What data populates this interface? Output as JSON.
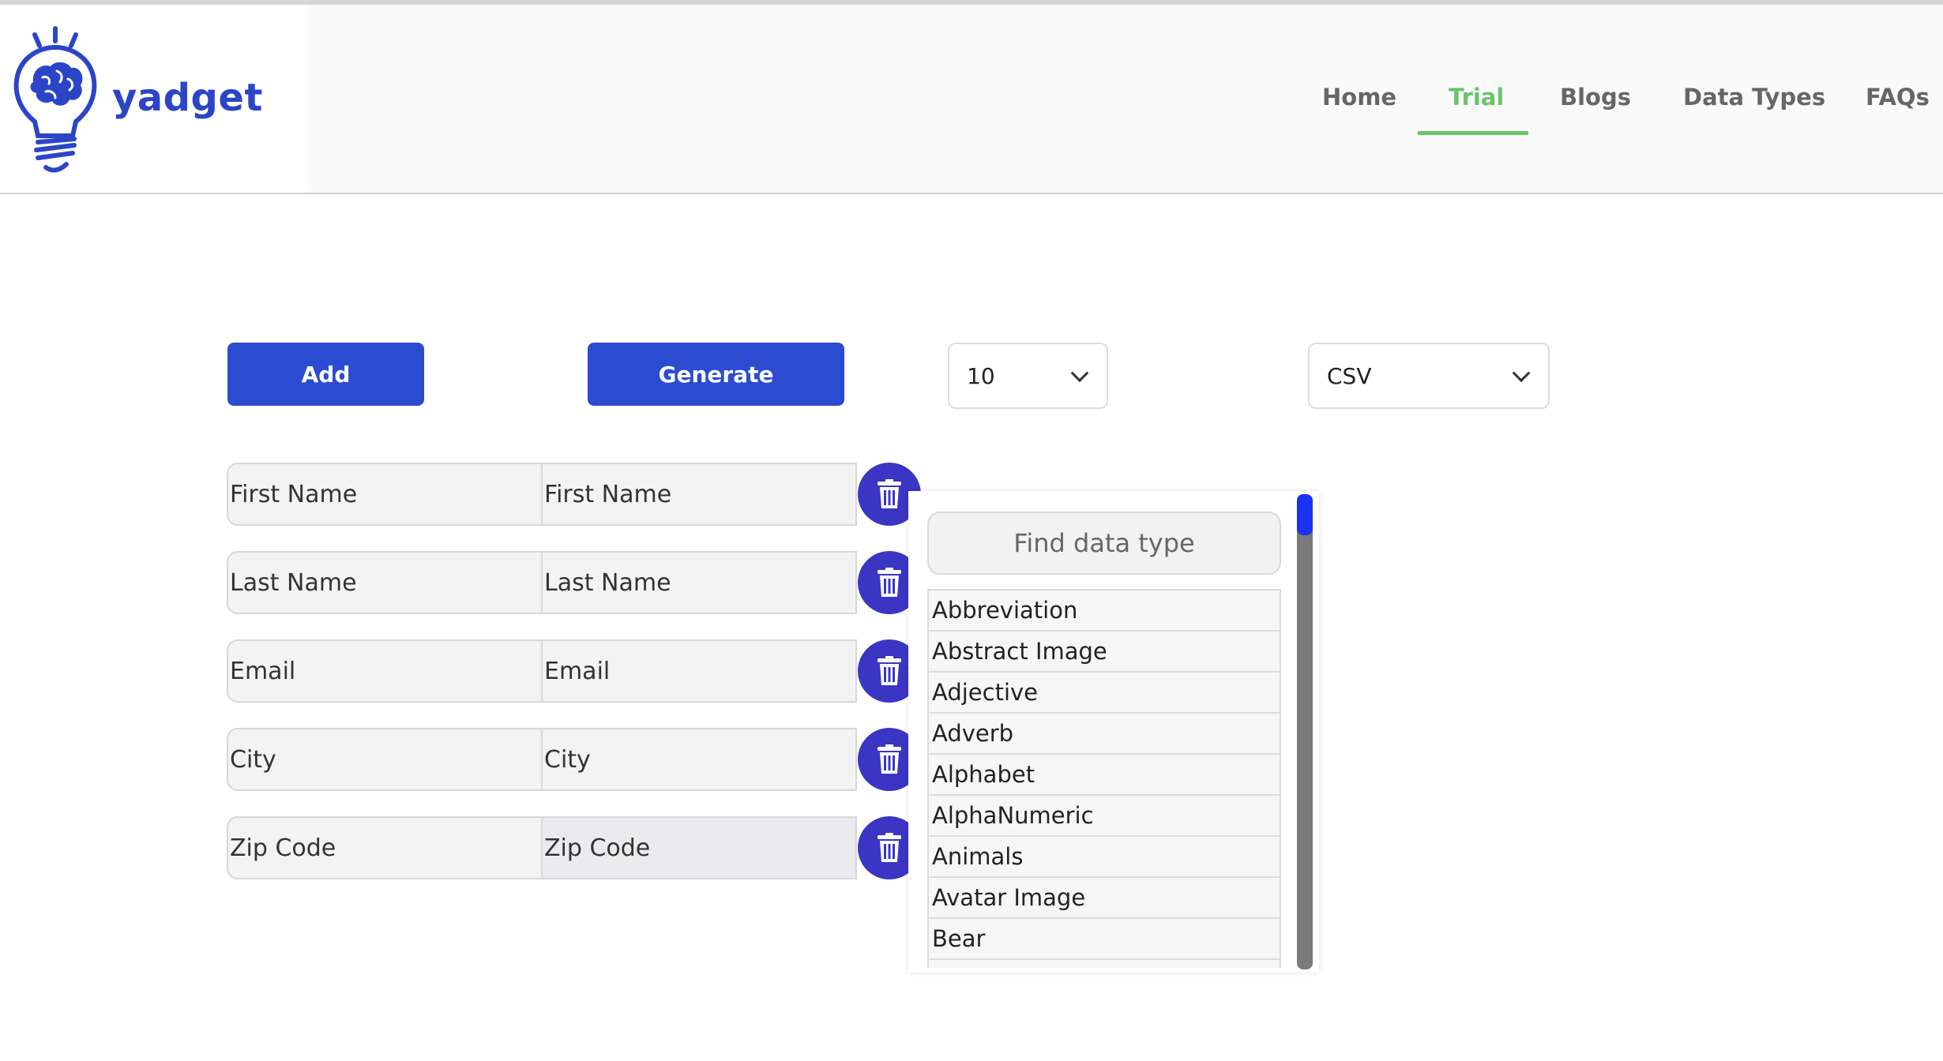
{
  "brand": {
    "name": "yadget",
    "color": "#2b45c9"
  },
  "nav": {
    "items": [
      {
        "label": "Home",
        "active": false
      },
      {
        "label": "Trial",
        "active": true
      },
      {
        "label": "Blogs",
        "active": false
      },
      {
        "label": "Data Types",
        "active": false
      },
      {
        "label": "FAQs",
        "active": false
      }
    ],
    "active_color": "#6cc36a"
  },
  "toolbar": {
    "add_label": "Add",
    "generate_label": "Generate",
    "row_count": "10",
    "format": "CSV"
  },
  "fields": [
    {
      "name": "First Name",
      "type": "First Name"
    },
    {
      "name": "Last Name",
      "type": "Last Name"
    },
    {
      "name": "Email",
      "type": "Email"
    },
    {
      "name": "City",
      "type": "City"
    },
    {
      "name": "Zip Code",
      "type": "Zip Code"
    }
  ],
  "datatype_dropdown": {
    "search_placeholder": "Find data type",
    "options": [
      "Abbreviation",
      "Abstract Image",
      "Adjective",
      "Adverb",
      "Alphabet",
      "AlphaNumeric",
      "Animals",
      "Avatar Image",
      "Bear"
    ],
    "scroll_position": 0
  },
  "icons": {
    "delete": "trash-icon",
    "logo": "lightbulb-brain-icon",
    "dropdown": "chevron-down-icon"
  },
  "colors": {
    "primary_button": "#2b4bd1",
    "delete_button": "#3b35c4",
    "scroll_thumb": "#1a33f0"
  }
}
